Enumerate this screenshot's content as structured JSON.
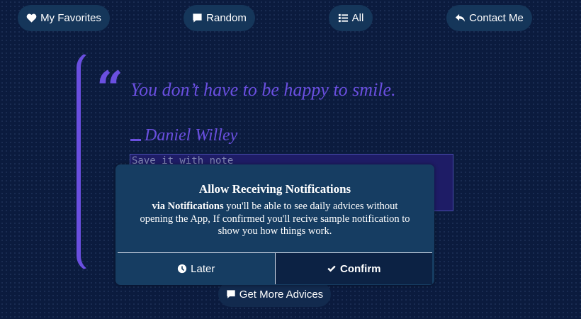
{
  "nav": {
    "favorites": {
      "label": "My Favorites",
      "icon": "heart-icon"
    },
    "random": {
      "label": "Random",
      "icon": "comment-icon"
    },
    "all": {
      "label": "All",
      "icon": "list-icon"
    },
    "contact": {
      "label": "Contact Me",
      "icon": "reply-icon"
    }
  },
  "quote": {
    "text": "You don’t have to be happy to smile.",
    "author": "Daniel Willey",
    "note_placeholder": "Save it with note"
  },
  "more_button": {
    "label": "Get More Advices",
    "icon": "comment-icon"
  },
  "modal": {
    "title": "Allow Receiving Notifications",
    "body_strong": "via Notifications",
    "body_rest": " you'll be able to see daily advices without opening the App, If confirmed you'll recive sample notification to show you how things work.",
    "later_label": "Later",
    "later_icon": "clock-icon",
    "confirm_label": "Confirm",
    "confirm_icon": "check-icon"
  },
  "colors": {
    "background": "#0b1b3e",
    "accent": "#6a4fe0",
    "button": "#15365a",
    "modal": "#163d62"
  }
}
